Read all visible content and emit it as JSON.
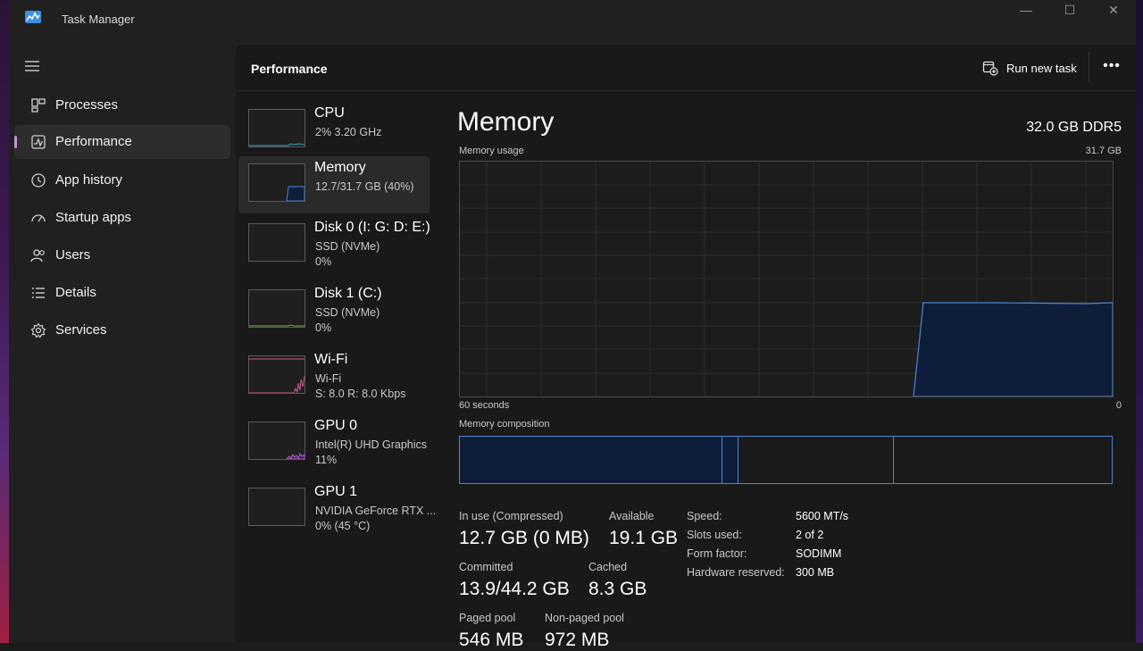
{
  "window": {
    "title": "Task Manager",
    "controls": {
      "minimize": "—",
      "maximize": "☐",
      "close": "✕"
    }
  },
  "nav": {
    "items": [
      {
        "label": "Processes",
        "icon": "processes-grid-icon"
      },
      {
        "label": "Performance",
        "icon": "performance-chart-icon",
        "active": true
      },
      {
        "label": "App history",
        "icon": "history-clock-icon"
      },
      {
        "label": "Startup apps",
        "icon": "startup-speedometer-icon"
      },
      {
        "label": "Users",
        "icon": "users-icon"
      },
      {
        "label": "Details",
        "icon": "details-list-icon"
      },
      {
        "label": "Services",
        "icon": "services-gear-icon"
      }
    ]
  },
  "page": {
    "title": "Performance",
    "run_new_task": "Run new task",
    "more": "•••"
  },
  "devices": [
    {
      "name": "CPU",
      "sub1": "2%  3.20 GHz"
    },
    {
      "name": "Memory",
      "sub1": "12.7/31.7 GB (40%)",
      "selected": true
    },
    {
      "name": "Disk 0 (I: G: D: E:)",
      "sub1": "SSD (NVMe)",
      "sub2": "0%"
    },
    {
      "name": "Disk 1 (C:)",
      "sub1": "SSD (NVMe)",
      "sub2": "0%"
    },
    {
      "name": "Wi-Fi",
      "sub1": "Wi-Fi",
      "sub2": "S: 8.0  R: 8.0 Kbps"
    },
    {
      "name": "GPU 0",
      "sub1": "Intel(R) UHD Graphics",
      "sub2": "11%"
    },
    {
      "name": "GPU 1",
      "sub1": "NVIDIA GeForce RTX ...",
      "sub2": "0% (45 °C)"
    }
  ],
  "detail": {
    "title": "Memory",
    "spec": "32.0 GB DDR5",
    "usage_label": "Memory usage",
    "usage_max": "31.7 GB",
    "x_left": "60 seconds",
    "x_right": "0",
    "composition_label": "Memory composition",
    "stats": {
      "in_use_label": "In use (Compressed)",
      "in_use": "12.7 GB (0 MB)",
      "available_label": "Available",
      "available": "19.1 GB",
      "committed_label": "Committed",
      "committed": "13.9/44.2 GB",
      "cached_label": "Cached",
      "cached": "8.3 GB",
      "paged_label": "Paged pool",
      "paged": "546 MB",
      "nonpaged_label": "Non-paged pool",
      "nonpaged": "972 MB"
    },
    "properties": [
      {
        "key": "Speed:",
        "value": "5600 MT/s"
      },
      {
        "key": "Slots used:",
        "value": "2 of 2"
      },
      {
        "key": "Form factor:",
        "value": "SODIMM"
      },
      {
        "key": "Hardware reserved:",
        "value": "300 MB"
      }
    ]
  },
  "colors": {
    "accent": "#c98ed8",
    "memory_line": "#4a86d8",
    "memory_fill": "#0e1d3a",
    "wifi_line": "#c85a8a",
    "gpu_line": "#b65ad0",
    "cpu_line": "#3aa6c8"
  }
}
